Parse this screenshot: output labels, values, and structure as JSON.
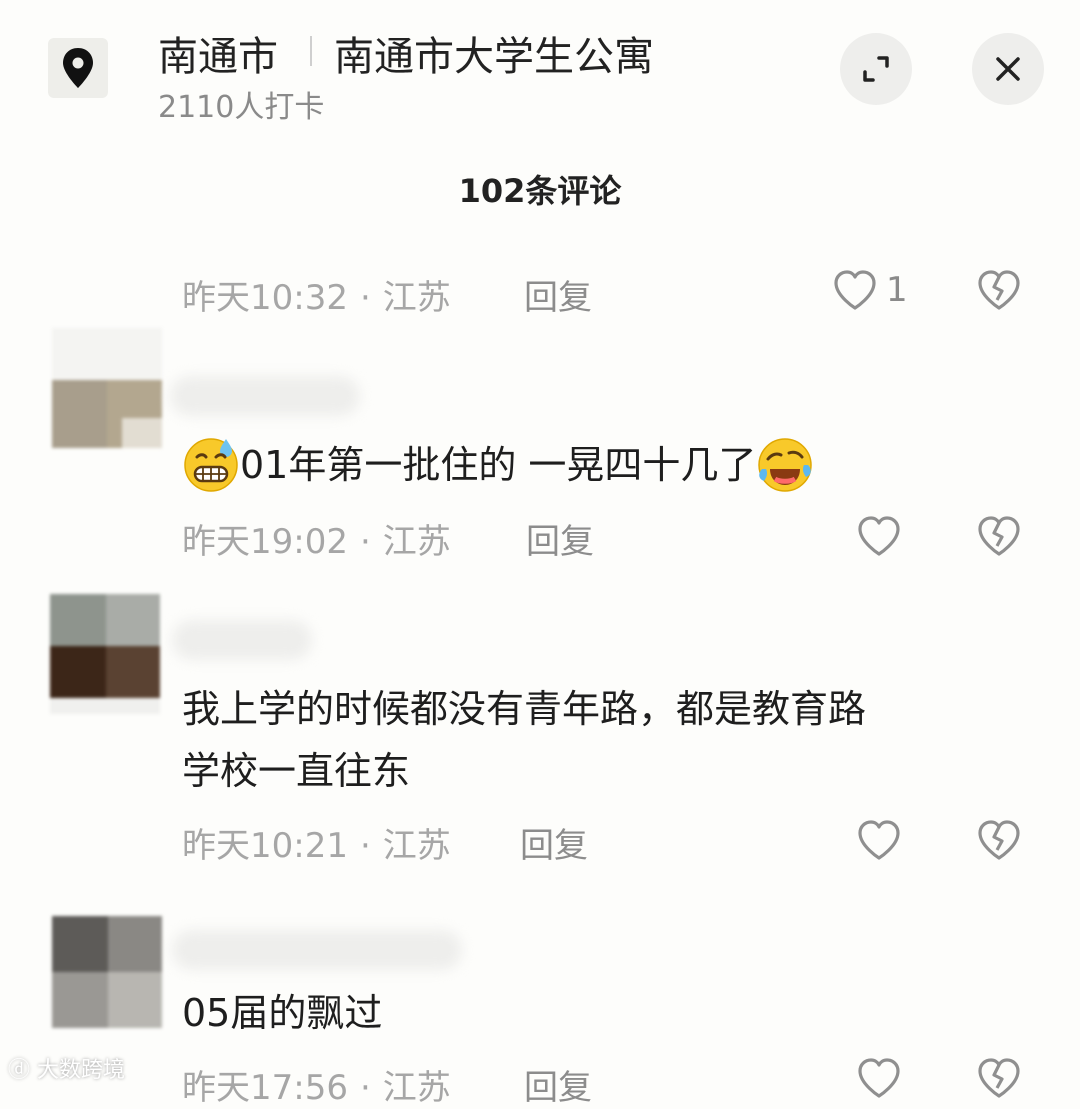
{
  "header": {
    "city": "南通市",
    "place": "南通市大学生公寓",
    "checkins": "2110人打卡"
  },
  "comments_title": "102条评论",
  "comments": [
    {
      "time": "昨天10:32",
      "region": "江苏",
      "reply": "回复",
      "likes": "1"
    },
    {
      "text": "01年第一批住的 一晃四十几了",
      "time": "昨天19:02",
      "region": "江苏",
      "reply": "回复"
    },
    {
      "text_line1": "我上学的时候都没有青年路，都是教育路",
      "text_line2": "学校一直往东",
      "time": "昨天10:21",
      "region": "江苏",
      "reply": "回复"
    },
    {
      "text": "05届的飘过",
      "time": "昨天17:56",
      "region": "江苏",
      "reply": "回复"
    }
  ],
  "dot": "·",
  "watermark": "大数跨境",
  "icons": {
    "pin": "map-pin-icon",
    "expand": "expand-icon",
    "close": "close-icon",
    "like": "heart-outline-icon",
    "dislike": "broken-heart-icon",
    "emoji_sweat": "grinning-sweat-emoji",
    "emoji_laugh": "rolling-laugh-emoji"
  },
  "colors": {
    "background": "#fdfdfb",
    "meta_text": "#a6a6a6",
    "icon_gray": "#8f8f8f"
  }
}
